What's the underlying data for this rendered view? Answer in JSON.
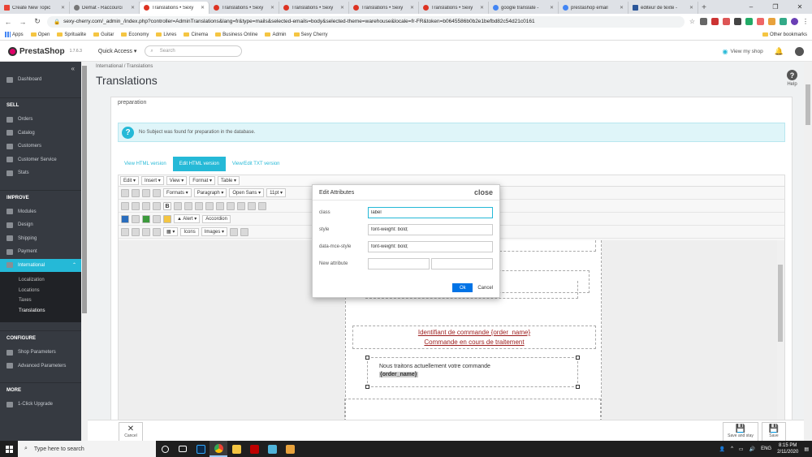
{
  "browser": {
    "tabs": [
      {
        "title": "Create New Topic",
        "icon": "gmail-icon",
        "active": false
      },
      {
        "title": "Demat - Raccourci",
        "icon": "site-icon",
        "active": false
      },
      {
        "title": "Translations • Sexy",
        "icon": "prestashop-icon",
        "active": true
      },
      {
        "title": "Translations • Sexy",
        "icon": "prestashop-icon",
        "active": false
      },
      {
        "title": "Translations • Sexy",
        "icon": "prestashop-icon",
        "active": false
      },
      {
        "title": "Translations • Sexy",
        "icon": "prestashop-icon",
        "active": false
      },
      {
        "title": "Translations • Sexy",
        "icon": "prestashop-icon",
        "active": false
      },
      {
        "title": "google translate -",
        "icon": "google-icon",
        "active": false
      },
      {
        "title": "prestashop email",
        "icon": "google-icon",
        "active": false
      },
      {
        "title": "éditeur de texte -",
        "icon": "word-icon",
        "active": false
      }
    ],
    "url": "sexy-cherry.com/_admin_/index.php?controller=AdminTranslations&lang=fr&type=mails&selected-emails=body&selected-theme=warehouse&locale=fr-FR&token=b0645586b0b2e1befbd82c54d21c0161",
    "bookmarks": [
      "Apps",
      "Open",
      "Spritualite",
      "Guitar",
      "Economy",
      "Livres",
      "Cinema",
      "Business Online",
      "Admin",
      "Sexy Cherry"
    ],
    "other_bookmarks": "Other bookmarks"
  },
  "header": {
    "logo": "PrestaShop",
    "version": "1.7.6.3",
    "quick_access": "Quick Access ▾",
    "search_placeholder": "Search",
    "view_shop": "View my shop"
  },
  "sidebar": {
    "collapse": "«",
    "dashboard": "Dashboard",
    "sections": [
      {
        "title": "SELL",
        "items": [
          "Orders",
          "Catalog",
          "Customers",
          "Customer Service",
          "Stats"
        ]
      },
      {
        "title": "IMPROVE",
        "items": [
          "Modules",
          "Design",
          "Shipping",
          "Payment",
          "International"
        ]
      }
    ],
    "international_sub": [
      "Localization",
      "Locations",
      "Taxes",
      "Translations"
    ],
    "configure": {
      "title": "CONFIGURE",
      "items": [
        "Shop Parameters",
        "Advanced Parameters"
      ]
    },
    "more": {
      "title": "MORE",
      "items": [
        "1-Click Upgrade"
      ]
    }
  },
  "page": {
    "breadcrumb": "International  /  Translations",
    "title": "Translations",
    "help": "Help",
    "prep_text": "preparation",
    "alert": "No Subject was found for preparation in the database.",
    "view_tabs": [
      "View HTML version",
      "Edit HTML version",
      "View/Edit TXT version"
    ]
  },
  "editor": {
    "menus": [
      "Edit ▾",
      "Insert ▾",
      "View ▾",
      "Format ▾",
      "Table ▾"
    ],
    "formats": "Formats ▾",
    "paragraph": "Paragraph ▾",
    "font": "Open Sans ▾",
    "size": "11pt ▾",
    "alert_btn": "Alert ▾",
    "accordion": "Accordion",
    "icons": "Icons",
    "images": "Images ▾",
    "block1_line1": "Identifiant de commande {order_name}",
    "block1_line2": "Commande en cours de traitement",
    "block2_text": "Nous traitons actuellement votre commande",
    "block2_bold": "{order_name}"
  },
  "modal": {
    "title": "Edit Attributes",
    "close": "close",
    "rows": [
      {
        "label": "class",
        "value": "label"
      },
      {
        "label": "style",
        "value": "font-weight: bold;"
      },
      {
        "label": "data-mce-style",
        "value": "font-weight: bold;"
      }
    ],
    "new_attr_label": "New attribute",
    "ok": "Ok",
    "cancel": "Cancel"
  },
  "bottom": {
    "cancel": "Cancel",
    "save_and_stay": "Save and stay",
    "save": "Save"
  },
  "taskbar": {
    "search": "Type here to search",
    "lang": "ENG",
    "time": "8:15 PM",
    "date": "2/11/2020"
  }
}
